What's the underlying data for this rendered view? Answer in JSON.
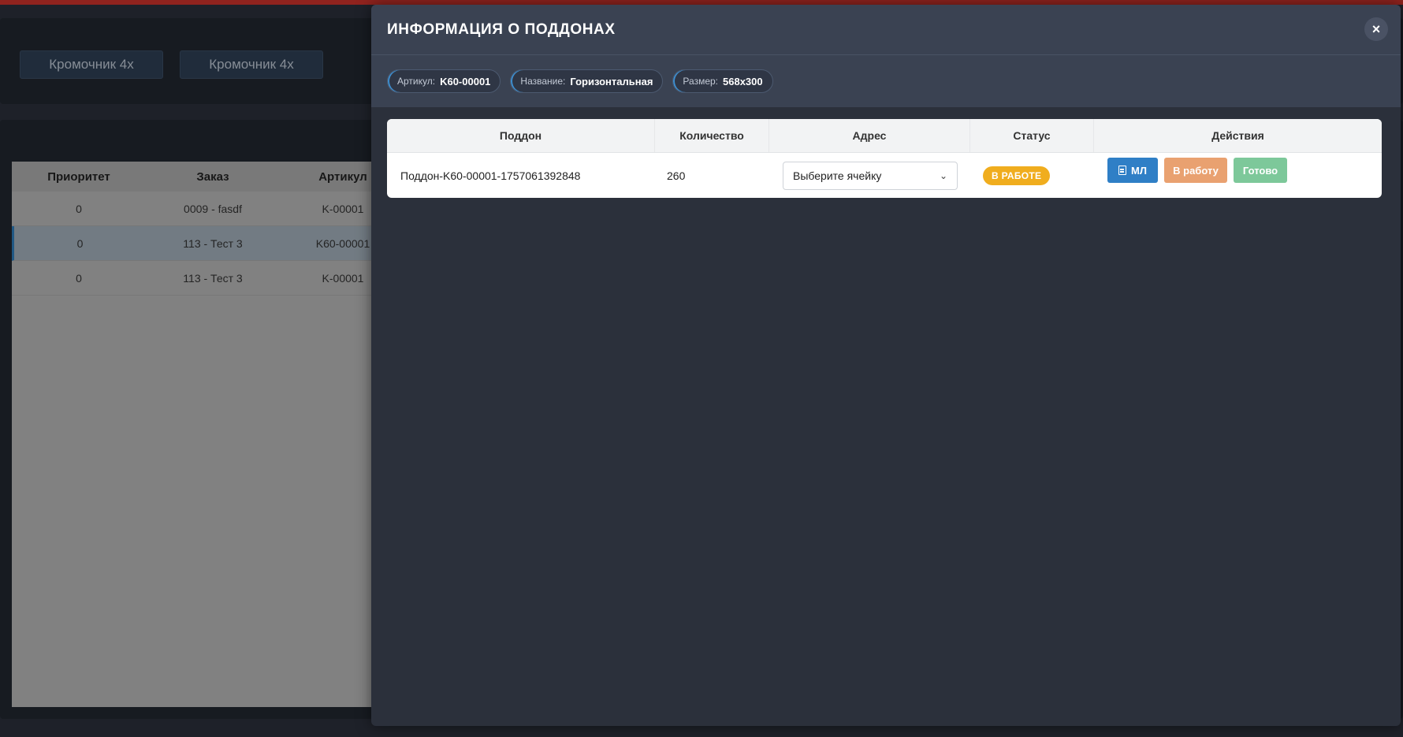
{
  "background": {
    "machines": [
      "Кромочник 4х",
      "Кромочник 4х"
    ],
    "table": {
      "columns": [
        "Приоритет",
        "Заказ",
        "Артикул"
      ],
      "rows": [
        {
          "priority": "0",
          "order": "0009 - fasdf",
          "article": "K-00001",
          "selected": false
        },
        {
          "priority": "0",
          "order": "113 - Тест 3",
          "article": "K60-00001",
          "selected": true
        },
        {
          "priority": "0",
          "order": "113 - Тест 3",
          "article": "K-00001",
          "selected": false
        }
      ]
    }
  },
  "modal": {
    "title": "ИНФОРМАЦИЯ О ПОДДОНАХ",
    "close_label": "×",
    "chips": [
      {
        "label": "Артикул:",
        "value": "K60-00001"
      },
      {
        "label": "Название:",
        "value": "Горизонтальная"
      },
      {
        "label": "Размер:",
        "value": "568x300"
      }
    ],
    "table": {
      "columns": [
        "Поддон",
        "Количество",
        "Адрес",
        "Статус",
        "Действия"
      ],
      "row": {
        "pallet": "Поддон-K60-00001-1757061392848",
        "quantity": "260",
        "address_placeholder": "Выберите ячейку",
        "status": "В РАБОТЕ",
        "status_color": "#f0ad1e"
      },
      "actions": {
        "ml_label": "МЛ",
        "work_label": "В работу",
        "done_label": "Готово"
      }
    }
  }
}
